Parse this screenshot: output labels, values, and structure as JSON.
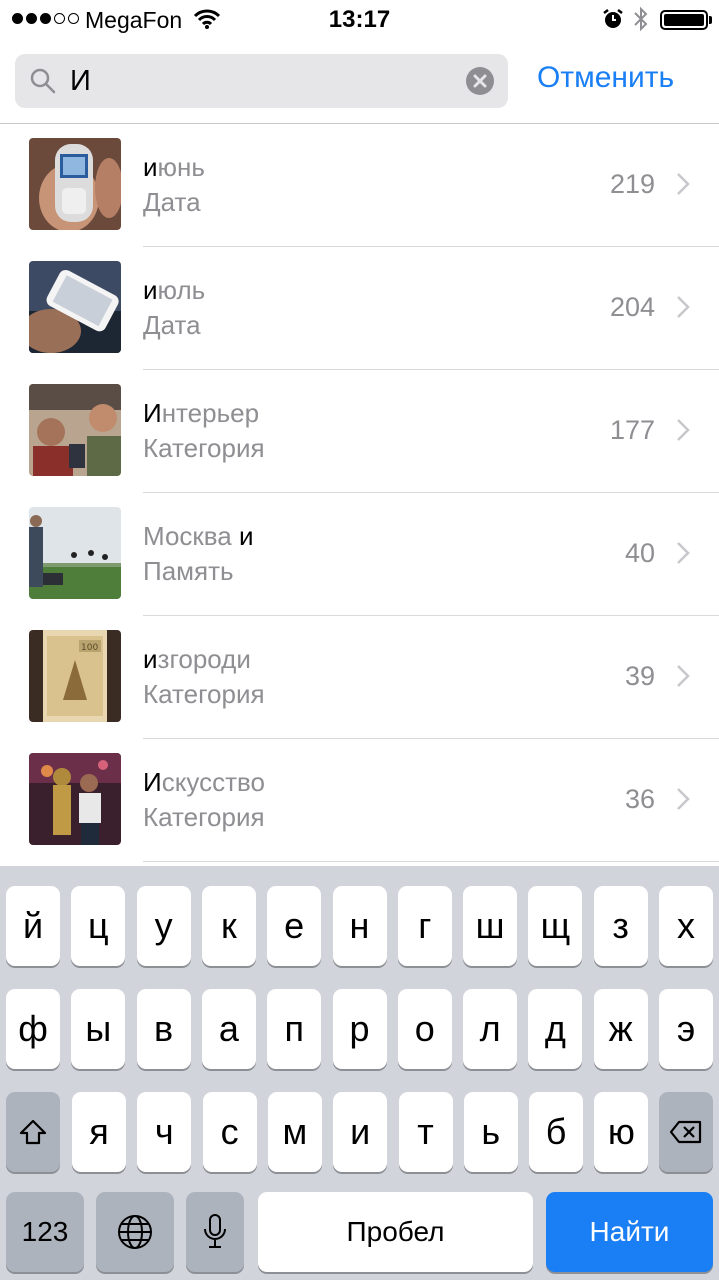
{
  "status_bar": {
    "carrier": "MegaFon",
    "time": "13:17",
    "signal_bars": 3,
    "icons": [
      "wifi-icon",
      "alarm-icon",
      "bluetooth-icon",
      "battery-icon"
    ]
  },
  "search": {
    "value": "И",
    "cancel_label": "Отменить"
  },
  "results": [
    {
      "hl": "и",
      "rest": "юнь",
      "pre": "",
      "subtitle": "Дата",
      "count": "219",
      "thumb": "phone-nokia-photo"
    },
    {
      "hl": "и",
      "rest": "юль",
      "pre": "",
      "subtitle": "Дата",
      "count": "204",
      "thumb": "phone-iphone-photo"
    },
    {
      "hl": "И",
      "rest": "нтерьер",
      "pre": "",
      "subtitle": "Категория",
      "count": "177",
      "thumb": "selfie-photo"
    },
    {
      "pre": "Москва ",
      "hl": "и",
      "rest": "",
      "subtitle": "Память",
      "count": "40",
      "thumb": "football-field-photo"
    },
    {
      "hl": "и",
      "rest": "згороди",
      "pre": "",
      "subtitle": "Категория",
      "count": "39",
      "thumb": "banknote-photo"
    },
    {
      "hl": "И",
      "rest": "скусство",
      "pre": "",
      "subtitle": "Категория",
      "count": "36",
      "thumb": "statue-photo"
    }
  ],
  "keyboard": {
    "row1": [
      "й",
      "ц",
      "у",
      "к",
      "е",
      "н",
      "г",
      "ш",
      "щ",
      "з",
      "х"
    ],
    "row2": [
      "ф",
      "ы",
      "в",
      "а",
      "п",
      "р",
      "о",
      "л",
      "д",
      "ж",
      "э"
    ],
    "row3": [
      "я",
      "ч",
      "с",
      "м",
      "и",
      "т",
      "ь",
      "б",
      "ю"
    ],
    "numbers_label": "123",
    "space_label": "Пробел",
    "go_label": "Найти"
  },
  "colors": {
    "accent": "#1a7ff5",
    "secondary_text": "#8e8e93",
    "keyboard_bg": "#d1d5db"
  }
}
